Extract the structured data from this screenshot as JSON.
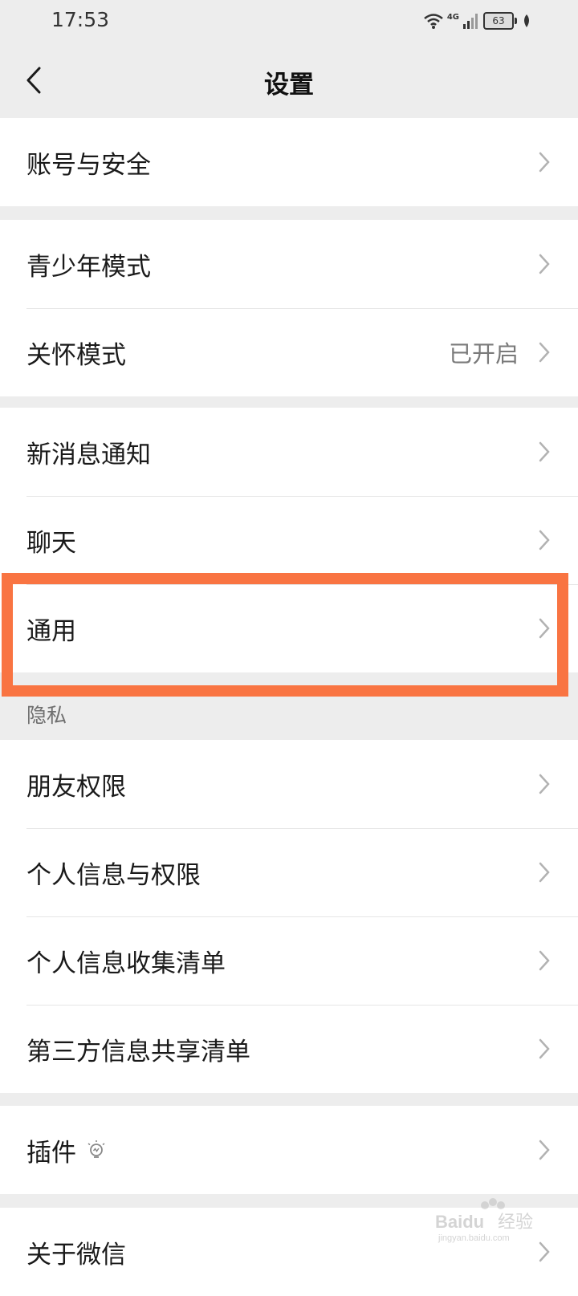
{
  "status_bar": {
    "time": "17:53",
    "network": "4G",
    "battery": "63"
  },
  "nav": {
    "title": "设置"
  },
  "groups": {
    "g1": [
      {
        "label": "账号与安全"
      }
    ],
    "g2": [
      {
        "label": "青少年模式"
      },
      {
        "label": "关怀模式",
        "value": "已开启"
      }
    ],
    "g3": [
      {
        "label": "新消息通知"
      },
      {
        "label": "聊天"
      },
      {
        "label": "通用"
      }
    ],
    "privacy_header": "隐私",
    "g4": [
      {
        "label": "朋友权限"
      },
      {
        "label": "个人信息与权限"
      },
      {
        "label": "个人信息收集清单"
      },
      {
        "label": "第三方信息共享清单"
      }
    ],
    "g5": [
      {
        "label": "插件"
      }
    ],
    "g6": [
      {
        "label": "关于微信"
      }
    ]
  },
  "highlight_color": "#f97442",
  "watermark": {
    "brand": "Baidu",
    "sub": "经验",
    "url": "jingyan.baidu.com"
  }
}
